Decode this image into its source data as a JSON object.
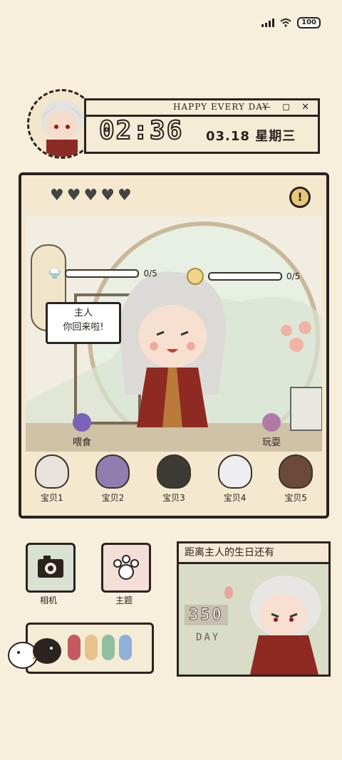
{
  "status_bar": {
    "battery": "100"
  },
  "clock": {
    "title": "HAPPY EVERY DAY",
    "window_controls": "— ◻ ✕",
    "time": "02:36",
    "date": "03.18 星期三"
  },
  "pet_panel": {
    "hearts": [
      "♥",
      "♥",
      "♥",
      "♥",
      "♥"
    ],
    "alert": "!",
    "food_meter": "0/5",
    "mood_meter": "0/5",
    "speech_line1": "主人",
    "speech_line2": "你回来啦!",
    "feed_label": "喂食",
    "play_label": "玩耍",
    "pets": [
      {
        "label": "宝贝1",
        "color": "#e8e3dc"
      },
      {
        "label": "宝贝2",
        "color": "#8f7fb0"
      },
      {
        "label": "宝贝3",
        "color": "#3d3a33"
      },
      {
        "label": "宝贝4",
        "color": "#eeeef0"
      },
      {
        "label": "宝贝5",
        "color": "#6b4a3a"
      }
    ]
  },
  "tiles": {
    "camera_label": "相机",
    "theme_label": "主题"
  },
  "birthday": {
    "title": "距离主人的生日还有",
    "count": "350",
    "unit": "DAY"
  },
  "palette": {
    "colors": [
      "#c55a5f",
      "#e8c28a",
      "#8fbf9f",
      "#8fb0d8"
    ]
  }
}
